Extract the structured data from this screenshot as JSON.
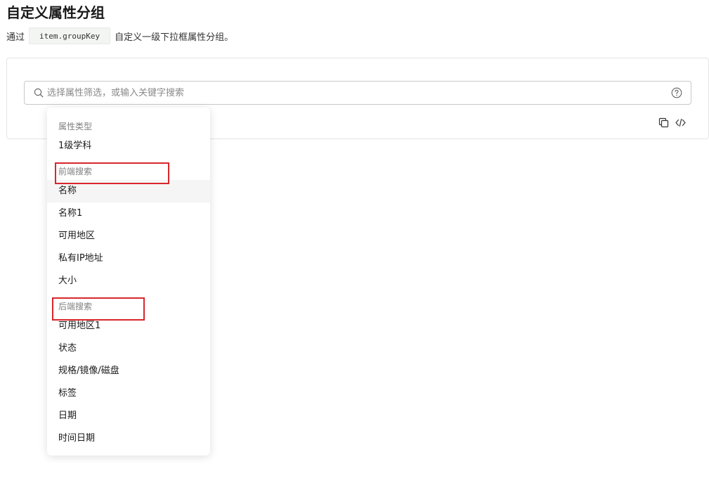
{
  "header": {
    "title": "自定义属性分组",
    "desc_prefix": "通过",
    "code": "item.groupKey",
    "desc_suffix": "自定义一级下拉框属性分组。"
  },
  "search": {
    "placeholder": "选择属性筛选，或输入关键字搜索",
    "value": ""
  },
  "icons": {
    "search": "search-icon",
    "help": "help-circle-icon",
    "copy": "copy-icon",
    "code": "code-icon"
  },
  "dropdown": {
    "groups": [
      {
        "label": "属性类型",
        "options": [
          "1级学科"
        ]
      },
      {
        "label": "前端搜索",
        "options": [
          "名称",
          "名称1",
          "可用地区",
          "私有IP地址",
          "大小"
        ]
      },
      {
        "label": "后端搜索",
        "options": [
          "可用地区1",
          "状态",
          "规格/镜像/磁盘",
          "标签",
          "日期",
          "时间日期"
        ]
      }
    ],
    "hovered_option": "名称"
  },
  "colors": {
    "highlight_border": "#d9262c",
    "hover_bg": "#f5f5f5"
  }
}
